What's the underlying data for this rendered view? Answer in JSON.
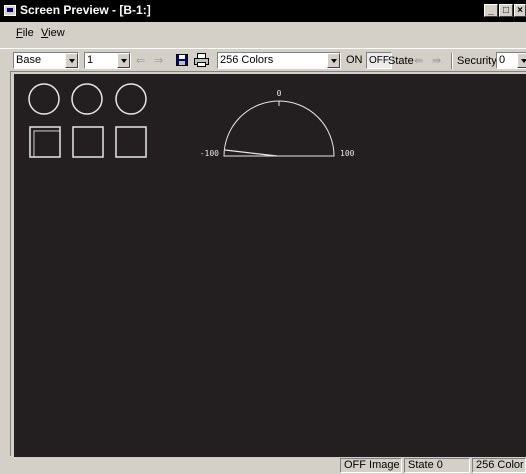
{
  "window": {
    "title": "Screen Preview - [B-1:]"
  },
  "menu": {
    "items": [
      "File",
      "View"
    ]
  },
  "toolbar": {
    "screen_type": "Base",
    "screen_number": "1",
    "color_mode": "256 Colors",
    "on_label": "ON",
    "off_label": "OFF",
    "state_label": "State",
    "security_label": "Security",
    "security_value": "0"
  },
  "meter": {
    "min_label": "-100",
    "max_label": "100",
    "mid_label": "0"
  },
  "status": {
    "image": "OFF Image",
    "state": "State 0",
    "colors": "256 Color"
  },
  "colors": {
    "canvas": "#231f20",
    "graphics": "#e6e6e6"
  }
}
